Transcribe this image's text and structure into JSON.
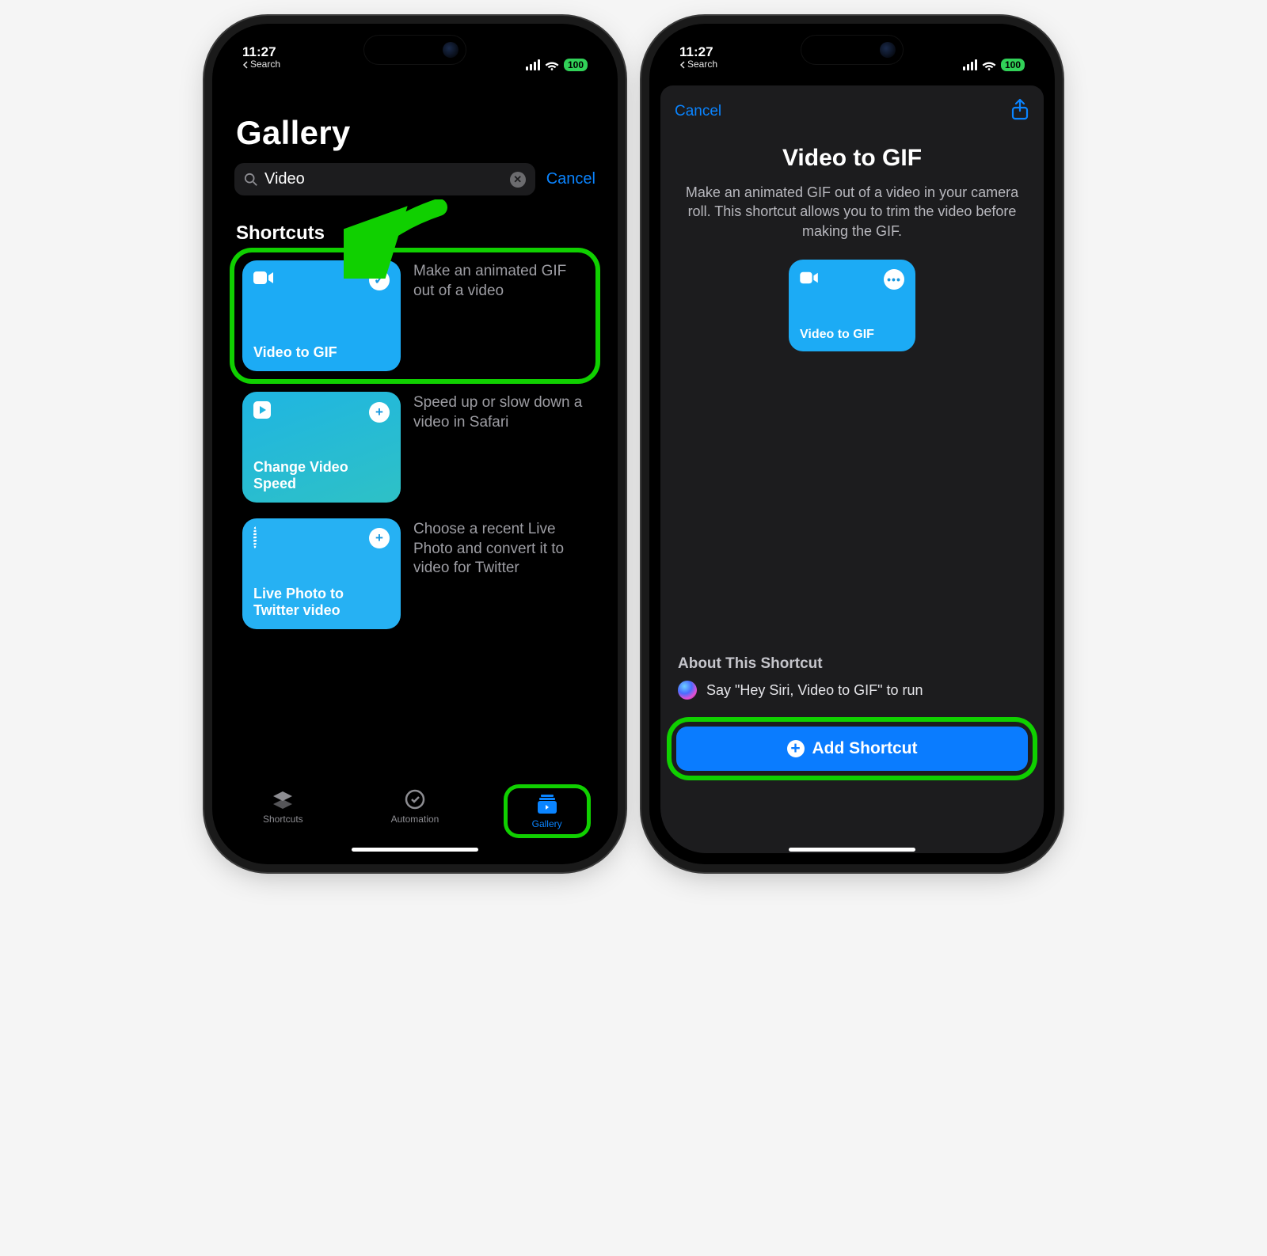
{
  "status": {
    "time": "11:27",
    "back_label": "Search",
    "battery": "100"
  },
  "left": {
    "page_title": "Gallery",
    "search_value": "Video",
    "cancel": "Cancel",
    "section": "Shortcuts",
    "items": [
      {
        "title": "Video to GIF",
        "desc": "Make an animated GIF out of a video",
        "added": true
      },
      {
        "title": "Change Video Speed",
        "desc": "Speed up or slow down a video in Safari",
        "added": false
      },
      {
        "title": "Live Photo to Twitter video",
        "desc": "Choose a recent Live Photo and convert it to video for Twitter",
        "added": false
      }
    ],
    "tabs": {
      "shortcuts": "Shortcuts",
      "automation": "Automation",
      "gallery": "Gallery"
    }
  },
  "right": {
    "cancel": "Cancel",
    "title": "Video to GIF",
    "description": "Make an animated GIF out of a video in your camera roll. This shortcut allows you to trim the video before making the GIF.",
    "card_title": "Video to GIF",
    "about_heading": "About This Shortcut",
    "siri_line": "Say \"Hey Siri, Video to GIF\" to run",
    "add_button": "Add Shortcut"
  }
}
